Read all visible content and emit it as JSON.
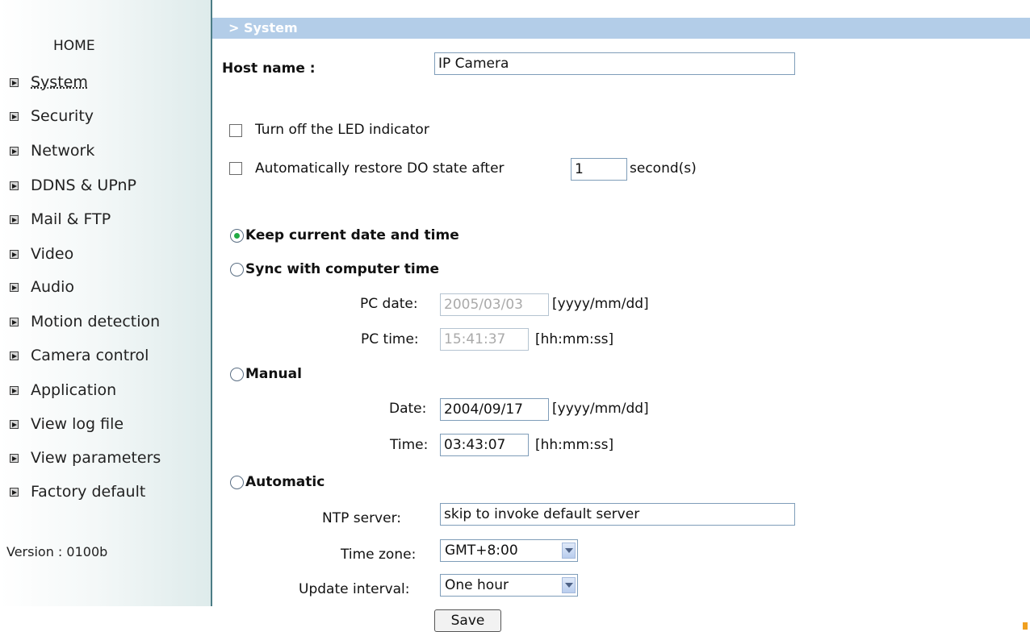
{
  "sidebar": {
    "home": "HOME",
    "items": [
      {
        "label": "System",
        "active": true
      },
      {
        "label": "Security"
      },
      {
        "label": "Network"
      },
      {
        "label": "DDNS & UPnP"
      },
      {
        "label": "Mail & FTP"
      },
      {
        "label": "Video"
      },
      {
        "label": "Audio"
      },
      {
        "label": "Motion detection"
      },
      {
        "label": "Camera control"
      },
      {
        "label": "Application"
      },
      {
        "label": "View log file"
      },
      {
        "label": "View parameters"
      },
      {
        "label": "Factory default"
      }
    ],
    "version": "Version : 0100b"
  },
  "page": {
    "title": "> System"
  },
  "host": {
    "label": "Host name :",
    "value": "IP Camera"
  },
  "led": {
    "label": "Turn off the LED indicator",
    "checked": false
  },
  "restore": {
    "label": "Automatically restore DO state after",
    "value": "1",
    "unit": "second(s)",
    "checked": false
  },
  "time_options": {
    "keep": {
      "label": "Keep current date and time",
      "selected": true
    },
    "sync": {
      "label": "Sync with computer time",
      "pc_date_label": "PC date:",
      "pc_date_value": "2005/03/03",
      "pc_date_format": "[yyyy/mm/dd]",
      "pc_time_label": "PC time:",
      "pc_time_value": "15:41:37",
      "pc_time_format": "[hh:mm:ss]"
    },
    "manual": {
      "label": "Manual",
      "date_label": "Date:",
      "date_value": "2004/09/17",
      "date_format": "[yyyy/mm/dd]",
      "time_label": "Time:",
      "time_value": "03:43:07",
      "time_format": "[hh:mm:ss]"
    },
    "automatic": {
      "label": "Automatic",
      "ntp_label": "NTP server:",
      "ntp_value": "skip to invoke default server",
      "tz_label": "Time zone:",
      "tz_value": "GMT+8:00",
      "interval_label": "Update interval:",
      "interval_value": "One hour"
    }
  },
  "save_label": "Save",
  "colors": {
    "title_bar": "#b3cde8",
    "sidebar_border": "#4c7d86",
    "radio_selected": "#22aa44"
  }
}
